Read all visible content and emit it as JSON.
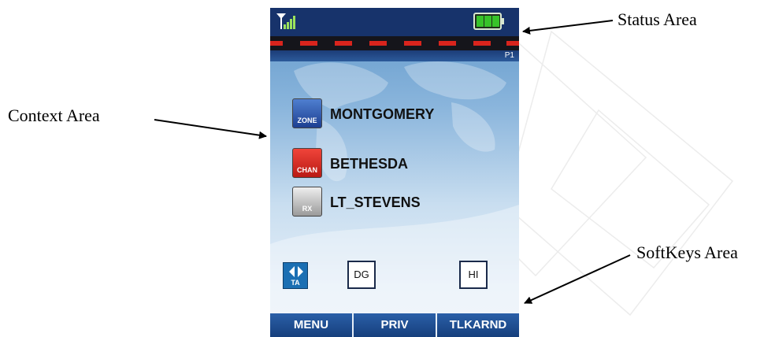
{
  "callouts": {
    "status_area": "Status Area",
    "context_area": "Context Area",
    "softkeys_area": "SoftKeys Area"
  },
  "status": {
    "page_indicator": "P1",
    "signal_icon": "antenna-signal-icon",
    "battery_icon": "battery-full-icon"
  },
  "context_rows": [
    {
      "badge": "ZONE",
      "label": "MONTGOMERY",
      "color": "#2350a8"
    },
    {
      "badge": "CHAN",
      "label": "BETHESDA",
      "color": "#d42a22"
    },
    {
      "badge": "RX",
      "label": "LT_STEVENS",
      "color": "#8a8a8a"
    }
  ],
  "indicators": {
    "ta": "TA",
    "dg": "DG",
    "hi": "HI"
  },
  "softkeys": [
    "MENU",
    "PRIV",
    "TLKARND"
  ],
  "colors": {
    "status_bg": "#17336b",
    "alert_red": "#d9241d",
    "softkey_blue": "#1f4f93"
  }
}
